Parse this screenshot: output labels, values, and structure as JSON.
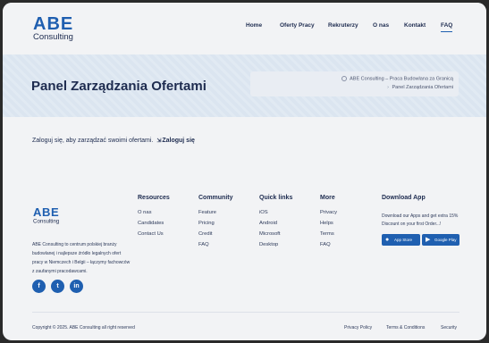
{
  "brand": {
    "logo_top": "ABE",
    "logo_bottom": "Consulting"
  },
  "nav": {
    "items": [
      {
        "label": "Home"
      },
      {
        "label": "Oferty Pracy"
      },
      {
        "label": "Rekruterzy"
      },
      {
        "label": "O nas"
      },
      {
        "label": "Kontakt"
      },
      {
        "label": "FAQ",
        "active": true
      }
    ]
  },
  "hero": {
    "title": "Panel Zarządzania Ofertami",
    "breadcrumb": {
      "home": "ABE Consulting – Praca Budowlana za Granicą",
      "current": "Panel Zarządzania Ofertami"
    }
  },
  "content": {
    "login_prompt": "Zaloguj się, aby zarządzać swoimi ofertami.",
    "login_link": "Zaloguj się"
  },
  "footer": {
    "description": "ABE Consulting to centrum polskiej branży budowlanej i najlepsze źródło legalnych ofert pracy w Niemczech i Belgii – łączymy fachowców z zaufanymi pracodawcami.",
    "social": [
      "facebook-icon",
      "twitter-icon",
      "linkedin-icon"
    ],
    "columns": [
      {
        "title": "Resources",
        "links": [
          "O nas",
          "Candidates",
          "Contact Us"
        ]
      },
      {
        "title": "Community",
        "links": [
          "Feature",
          "Pricing",
          "Credit",
          "FAQ"
        ]
      },
      {
        "title": "Quick links",
        "links": [
          "iOS",
          "Android",
          "Microsoft",
          "Desktop"
        ]
      },
      {
        "title": "More",
        "links": [
          "Privacy",
          "Helps",
          "Terms",
          "FAQ"
        ]
      }
    ],
    "download": {
      "title": "Download App",
      "text": "Download our Apps and get extra 15% Discount on your first Order...!",
      "app_store": "App Store",
      "google_play": "Google Play"
    },
    "copyright": "Copyright © 2025. ABE Consulting all right reserved",
    "legal": [
      "Privacy Policy",
      "Terms & Conditions",
      "Security"
    ]
  },
  "colors": {
    "accent": "#1f5fb0",
    "text": "#1d2b4f",
    "hero_bg": "#dbe5f0",
    "page_bg": "#f2f3f5"
  }
}
